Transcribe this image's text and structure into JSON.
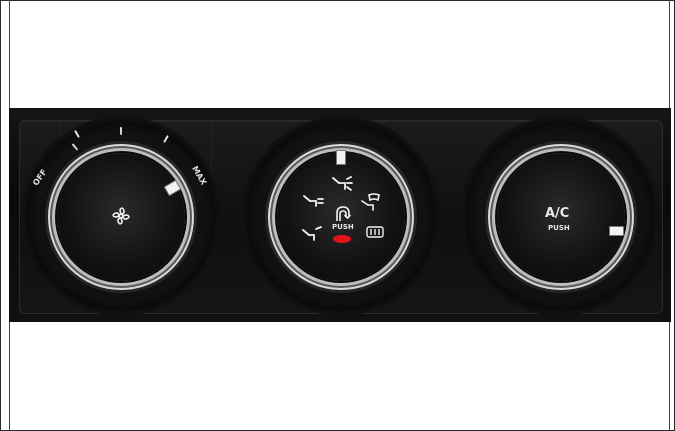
{
  "fan_knob": {
    "off_label": "OFF",
    "max_label": "MAX",
    "icon": "fan-icon"
  },
  "mode_knob": {
    "push_label": "PUSH",
    "icons": [
      "face-vent-icon",
      "face-feet-vent-icon",
      "windshield-feet-icon",
      "feet-vent-icon",
      "recirculation-icon",
      "rear-defrost-icon"
    ],
    "indicator_color": "#e1131b"
  },
  "ac_knob": {
    "label": "A/C",
    "push_label": "PUSH"
  }
}
